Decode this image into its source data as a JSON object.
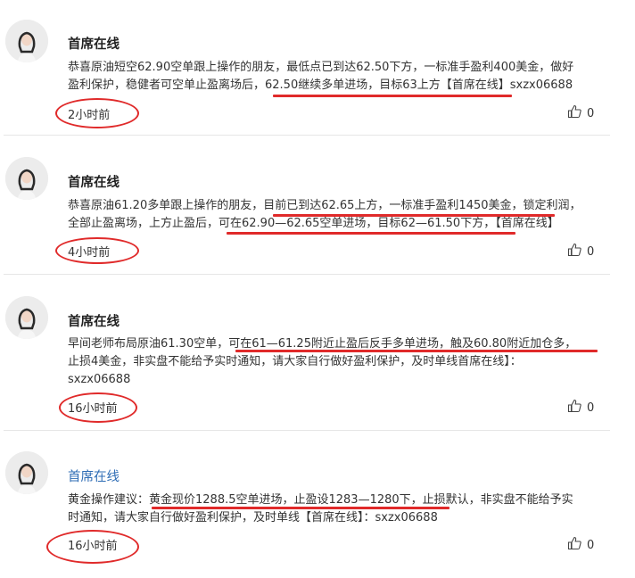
{
  "posts": [
    {
      "author": "首席在线",
      "lines": [
        "恭喜原油短空62.90空单跟上操作的朋友，最低点已到达62.50下方，一标准手盈利400美金，做好",
        "盈利保护，稳健者可空单止盈离场后，62.50继续多单进场，目标63上方【首席在线】sxzx06688"
      ],
      "time": "2小时前",
      "likes": "0"
    },
    {
      "author": "首席在线",
      "lines": [
        "恭喜原油61.20多单跟上操作的朋友，目前已到达62.65上方，一标准手盈利1450美金，锁定利润，",
        "全部止盈离场，上方止盈后，可在62.90—62.65空单进场，目标62—61.50下方，【首席在线】"
      ],
      "time": "4小时前",
      "likes": "0"
    },
    {
      "author": "首席在线",
      "lines": [
        "早间老师布局原油61.30空单，可在61—61.25附近止盈后反手多单进场，触及60.80附近加仓多，",
        "止损4美金，非实盘不能给予实时通知，请大家自行做好盈利保护，及时单线首席在线】：",
        "sxzx06688"
      ],
      "time": "16小时前",
      "likes": "0"
    },
    {
      "author": "首席在线",
      "lines": [
        "黄金操作建议：黄金现价1288.5空单进场，止盈设1283—1280下，止损默认，非实盘不能给予实",
        "时通知，请大家自行做好盈利保护，及时单线【首席在线】：sxzx06688"
      ],
      "time": "16小时前",
      "likes": "0"
    }
  ],
  "icons": {
    "like": "thumbs-up-icon",
    "avatar": "avatar-photo"
  },
  "colors": {
    "annotation": "#e02a2a",
    "author_link": "#2f6db5"
  }
}
